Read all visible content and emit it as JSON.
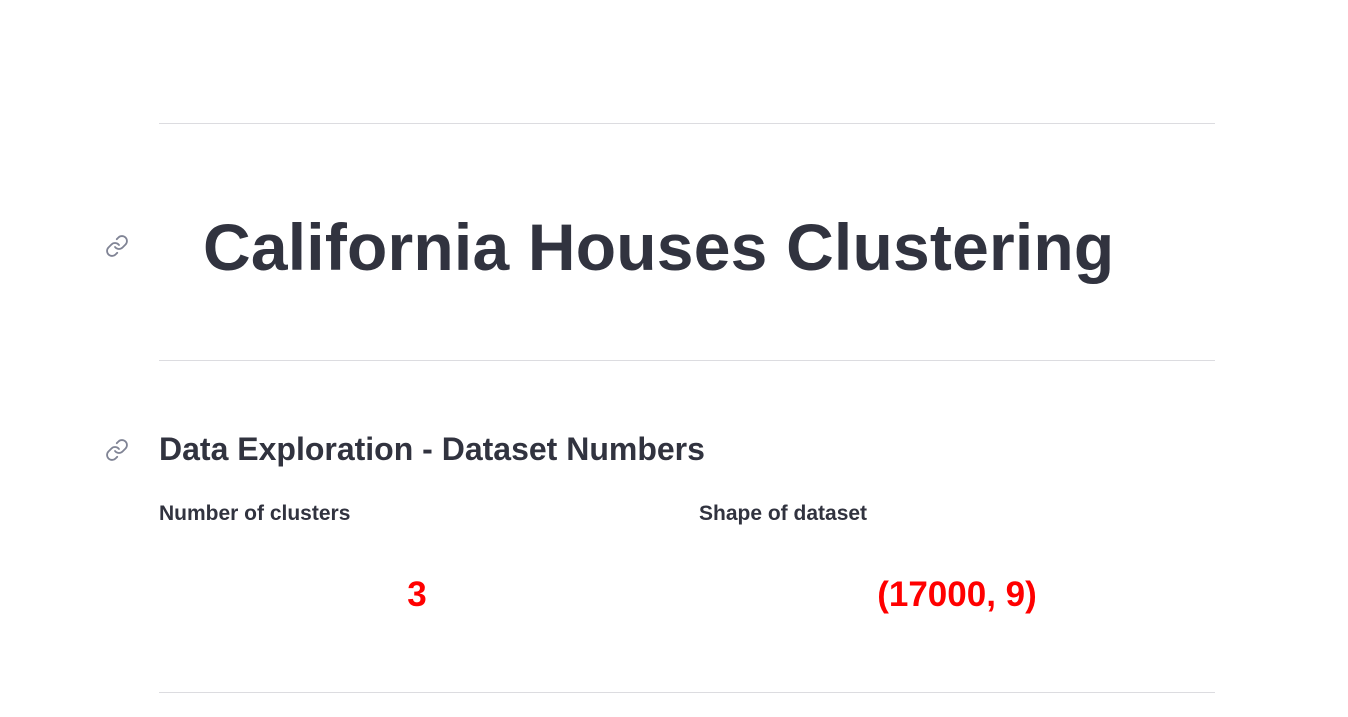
{
  "page": {
    "title": "California Houses Clustering",
    "section_heading": "Data Exploration - Dataset Numbers"
  },
  "metrics": [
    {
      "label": "Number of clusters",
      "value": "3"
    },
    {
      "label": "Shape of dataset",
      "value": "(17000, 9)"
    }
  ],
  "icons": {
    "title_anchor": "link-icon",
    "section_anchor": "link-icon"
  },
  "colors": {
    "text": "#31333f",
    "metric_value": "#ff0000",
    "divider": "#dcdce0",
    "anchor_icon": "#808495"
  }
}
